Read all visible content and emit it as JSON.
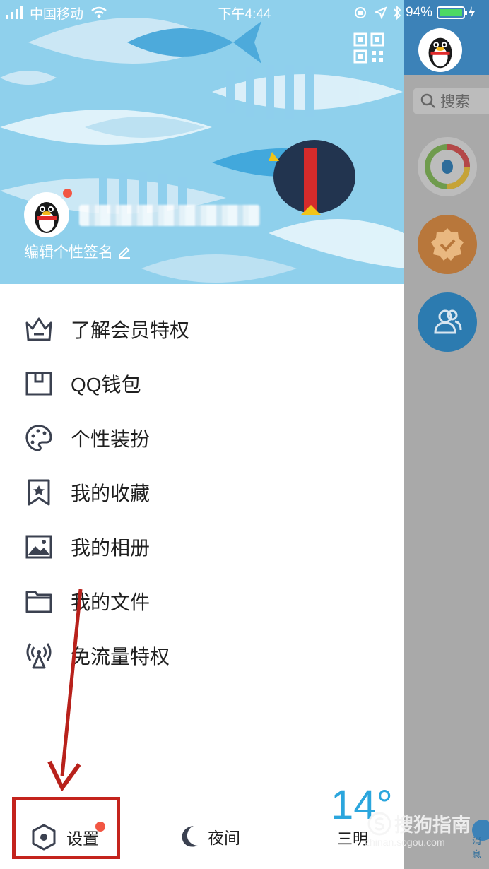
{
  "status_bar": {
    "carrier": "中国移动",
    "time": "下午4:44",
    "battery": "94%"
  },
  "profile": {
    "signature": "编辑个性签名"
  },
  "menu": [
    {
      "label": "了解会员特权",
      "icon": "crown-icon"
    },
    {
      "label": "QQ钱包",
      "icon": "wallet-icon"
    },
    {
      "label": "个性装扮",
      "icon": "palette-icon"
    },
    {
      "label": "我的收藏",
      "icon": "bookmark-star-icon"
    },
    {
      "label": "我的相册",
      "icon": "photo-icon"
    },
    {
      "label": "我的文件",
      "icon": "folder-icon"
    },
    {
      "label": "免流量特权",
      "icon": "signal-tower-icon"
    }
  ],
  "bottom_bar": {
    "settings_label": "设置",
    "night_label": "夜间",
    "weather_temp": "14°",
    "weather_city": "三明"
  },
  "right_panel": {
    "search_placeholder": "搜索",
    "tab_partial": "消息"
  },
  "watermark": {
    "brand": "搜狗指南",
    "url": "zhinan.sogou.com"
  },
  "colors": {
    "hero_bg": "#8fd0ec",
    "highlight": "#c4231d",
    "badge": "#f25643",
    "weather": "#2ba6dd",
    "icon_stroke": "#3b4150"
  }
}
